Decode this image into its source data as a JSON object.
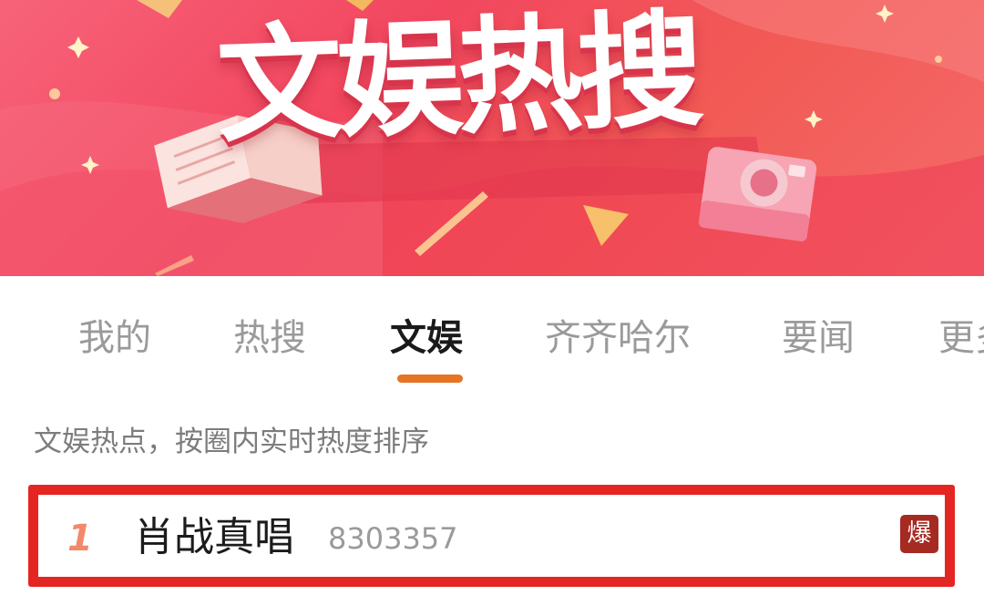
{
  "banner": {
    "title": "文娱热搜",
    "icons": [
      "book-icon",
      "camera-icon",
      "sparkle-icon"
    ]
  },
  "tabs": [
    {
      "label": "我的",
      "active": false
    },
    {
      "label": "热搜",
      "active": false
    },
    {
      "label": "文娱",
      "active": true
    },
    {
      "label": "齐齐哈尔",
      "active": false
    },
    {
      "label": "要闻",
      "active": false
    },
    {
      "label": "更多",
      "active": false
    }
  ],
  "subtitle": "文娱热点，按圈内实时热度排序",
  "hot_list": [
    {
      "rank": "1",
      "title": "肖战真唱",
      "count": "8303357",
      "badge": "爆"
    }
  ],
  "colors": {
    "banner": "#f2475f",
    "accent": "#e57424",
    "highlight_border": "#e52521",
    "badge": "#a52a22",
    "rank": "#f08a6a"
  }
}
